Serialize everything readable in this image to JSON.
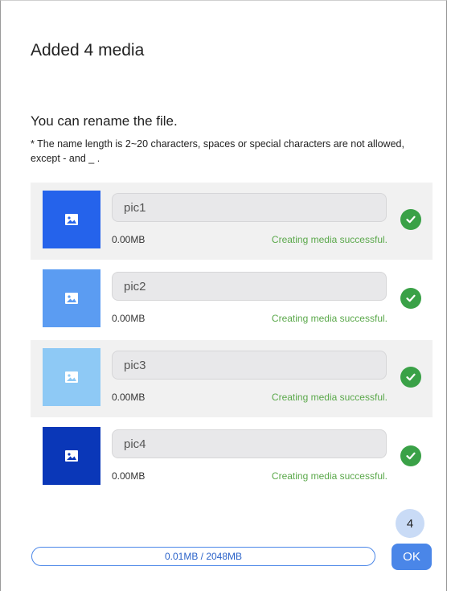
{
  "dialog": {
    "title": "Added 4 media",
    "subtitle": "You can rename the file.",
    "hint": "* The name length is 2~20 characters, spaces or special characters are not allowed, except - and _ ."
  },
  "media": [
    {
      "name": "pic1",
      "size": "0.00MB",
      "status": "Creating media successful.",
      "thumb_color": "#2563eb",
      "icon": "image-icon"
    },
    {
      "name": "pic2",
      "size": "0.00MB",
      "status": "Creating media successful.",
      "thumb_color": "#5b9cf2",
      "icon": "image-icon"
    },
    {
      "name": "pic3",
      "size": "0.00MB",
      "status": "Creating media successful.",
      "thumb_color": "#8ec9f5",
      "icon": "image-icon"
    },
    {
      "name": "pic4",
      "size": "0.00MB",
      "status": "Creating media successful.",
      "thumb_color": "#0a37b8",
      "icon": "image-icon"
    }
  ],
  "footer": {
    "usage_label": "0.01MB / 2048MB",
    "usage_fraction": 4.9e-06,
    "count": "4",
    "ok_label": "OK"
  },
  "colors": {
    "accent": "#4a86e8",
    "success": "#3aa147",
    "status_text": "#5aa84a"
  }
}
